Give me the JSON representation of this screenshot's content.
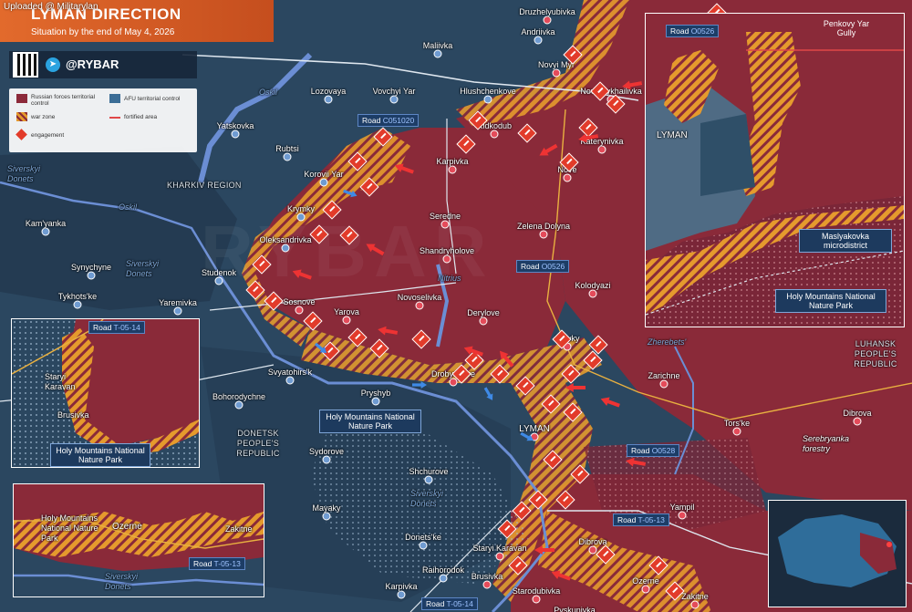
{
  "upload_note": "Uploaded @ Militarylan",
  "header": {
    "title": "LYMAN DIRECTION",
    "subtitle": "Situation by the end of May 4, 2026"
  },
  "social": {
    "handle": "@RYBAR",
    "tg_icon": "telegram-icon",
    "qr_icon": "qr-code-icon"
  },
  "legend": {
    "items": [
      {
        "label": "Russian forces territorial control",
        "color": "#8c2a3a"
      },
      {
        "label": "AFU territorial control",
        "color": "#3b6d96"
      },
      {
        "label": "war zone",
        "color": "#e0962a"
      },
      {
        "label": "fortified area",
        "color": "#e04848"
      },
      {
        "label": "engagement",
        "color": "#e23b2a"
      }
    ]
  },
  "colors": {
    "russian": "#8a2a39",
    "afu": "#2f5778",
    "warzone": "#e59a2d",
    "water": "#6d8fd0",
    "river": "#6b8ed4"
  },
  "regions": {
    "kharkiv": "KHARKIV REGION",
    "donetsk": "DONETSK PEOPLE'S REPUBLIC",
    "luhansk": "LUHANSK PEOPLE'S REPUBLIC"
  },
  "water": {
    "oskil1": "Oskil",
    "oskil2": "Oskil",
    "siverskyi1": "Siverskyi Donets",
    "siverskyi2": "Siverskyi Donets",
    "siverskyi3": "Siverskyi Donets",
    "nitrius": "Nitrius",
    "zherebets": "Zherebets'",
    "siverskyi4": "Siverskyi Donets"
  },
  "places": [
    {
      "name": "Druzhelyubivka"
    },
    {
      "name": "Maliivka"
    },
    {
      "name": "Andriivka"
    },
    {
      "name": "Novyi Myr"
    },
    {
      "name": "Lozovaya"
    },
    {
      "name": "Vovchyi Yar"
    },
    {
      "name": "Hlushchenkove"
    },
    {
      "name": "Novomykhailivka"
    },
    {
      "name": "Yatskovka"
    },
    {
      "name": "Rubtsi"
    },
    {
      "name": "Ridkodub"
    },
    {
      "name": "Katerynivka"
    },
    {
      "name": "Korovii Yar"
    },
    {
      "name": "Karpivka"
    },
    {
      "name": "Nove"
    },
    {
      "name": "Kam'yanka"
    },
    {
      "name": "Krymky"
    },
    {
      "name": "Seredne"
    },
    {
      "name": "Zelena Dolyna"
    },
    {
      "name": "Oleksandrivka"
    },
    {
      "name": "Shandryholove"
    },
    {
      "name": "Synychyne"
    },
    {
      "name": "Studenok"
    },
    {
      "name": "Kolodyazi"
    },
    {
      "name": "Tykhots'ke"
    },
    {
      "name": "Yaremivka"
    },
    {
      "name": "Sosnove"
    },
    {
      "name": "Novoselivka"
    },
    {
      "name": "Derylove"
    },
    {
      "name": "Yarova"
    },
    {
      "name": "Stavky"
    },
    {
      "name": "Svyatohirs'k"
    },
    {
      "name": "Drobysheve"
    },
    {
      "name": "Zarichne"
    },
    {
      "name": "Bohorodychne"
    },
    {
      "name": "Pryshyb"
    },
    {
      "name": "LYMAN"
    },
    {
      "name": "Tors'ke"
    },
    {
      "name": "Dibrova"
    },
    {
      "name": "Sydorove"
    },
    {
      "name": "Shchurove"
    },
    {
      "name": "Yampil"
    },
    {
      "name": "Mayaky"
    },
    {
      "name": "Donets'ke"
    },
    {
      "name": "Staryi Karavan"
    },
    {
      "name": "Dibrova"
    },
    {
      "name": "Raihorodok"
    },
    {
      "name": "Brusivka"
    },
    {
      "name": "Karpivka"
    },
    {
      "name": "Starodubivka"
    },
    {
      "name": "Ozerne"
    },
    {
      "name": "Zakitne"
    },
    {
      "name": "Pyskunivka"
    }
  ],
  "roads": {
    "c051020": {
      "prefix": "Road ",
      "num": "C051020"
    },
    "o0526": {
      "prefix": "Road ",
      "num": "O0526"
    },
    "o0528": {
      "prefix": "Road ",
      "num": "O0528"
    },
    "t0513": {
      "prefix": "Road ",
      "num": "T-05-13"
    },
    "t0514": {
      "prefix": "Road ",
      "num": "T-05-14"
    }
  },
  "park_main": "Holy Mountains National Nature Park",
  "serebryanka": "Serebryanka forestry",
  "inset_tr": {
    "road": {
      "prefix": "Road ",
      "num": "O0526"
    },
    "gully": "Penkovy Yar Gully",
    "lyman": "LYMAN",
    "microdistrict": "Maslyakovka microdistrict",
    "park": "Holy Mountains National Nature Park"
  },
  "inset_l": {
    "road": {
      "prefix": "Road ",
      "num": "T-05-14"
    },
    "staryi": "Staryi Karavan",
    "brusivka": "Brusivka",
    "park": "Holy Mountains National Nature Park"
  },
  "inset_bl": {
    "park": "Holy Mountains National Nature Park",
    "ozerne": "Ozerne",
    "zakitne": "Zakitne",
    "road": {
      "prefix": "Road ",
      "num": "T-05-13"
    },
    "siverskyi": "Siverskyi Donets"
  }
}
